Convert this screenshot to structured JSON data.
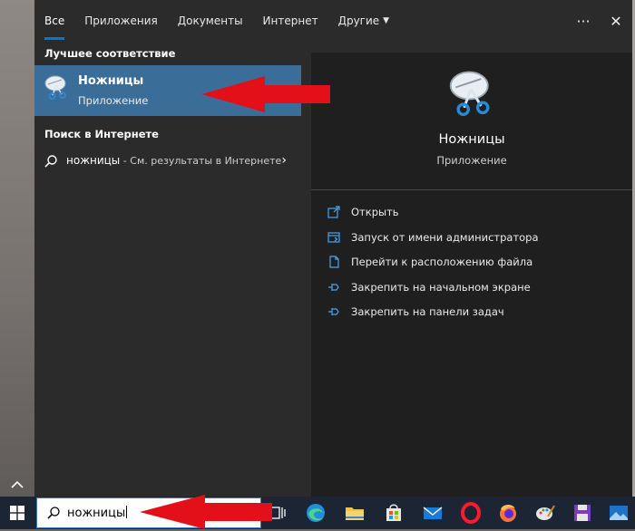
{
  "tabs": [
    {
      "label": "Все",
      "active": true
    },
    {
      "label": "Приложения"
    },
    {
      "label": "Документы"
    },
    {
      "label": "Интернет"
    },
    {
      "label": "Другие"
    }
  ],
  "top_actions": {
    "more": "···",
    "close": "✕"
  },
  "left": {
    "best_match_title": "Лучшее соответствие",
    "best_match": {
      "name": "Ножницы",
      "type": "Приложение",
      "icon": "snipping-tool-icon"
    },
    "web_title": "Поиск в Интернете",
    "web_item": {
      "query": "ножницы",
      "rest": " - См. результаты в Интернете"
    }
  },
  "right": {
    "title": "Ножницы",
    "subtitle": "Приложение",
    "actions": [
      {
        "label": "Открыть",
        "icon": "open-icon"
      },
      {
        "label": "Запуск от имени администратора",
        "icon": "run-as-admin-icon"
      },
      {
        "label": "Перейти к расположению файла",
        "icon": "file-location-icon"
      },
      {
        "label": "Закрепить на начальном экране",
        "icon": "pin-icon"
      },
      {
        "label": "Закрепить на панели задач",
        "icon": "pin-icon"
      }
    ]
  },
  "taskbar": {
    "search_value": "ножницы",
    "icons": [
      "task-view-icon",
      "edge-icon",
      "file-explorer-icon",
      "store-icon",
      "mail-icon",
      "opera-icon",
      "firefox-icon",
      "paint-icon",
      "save-icon",
      "photos-icon"
    ]
  },
  "colors": {
    "accent": "#0078d7",
    "selection": "#3a6e99",
    "annotation_arrow": "#e3101a"
  }
}
